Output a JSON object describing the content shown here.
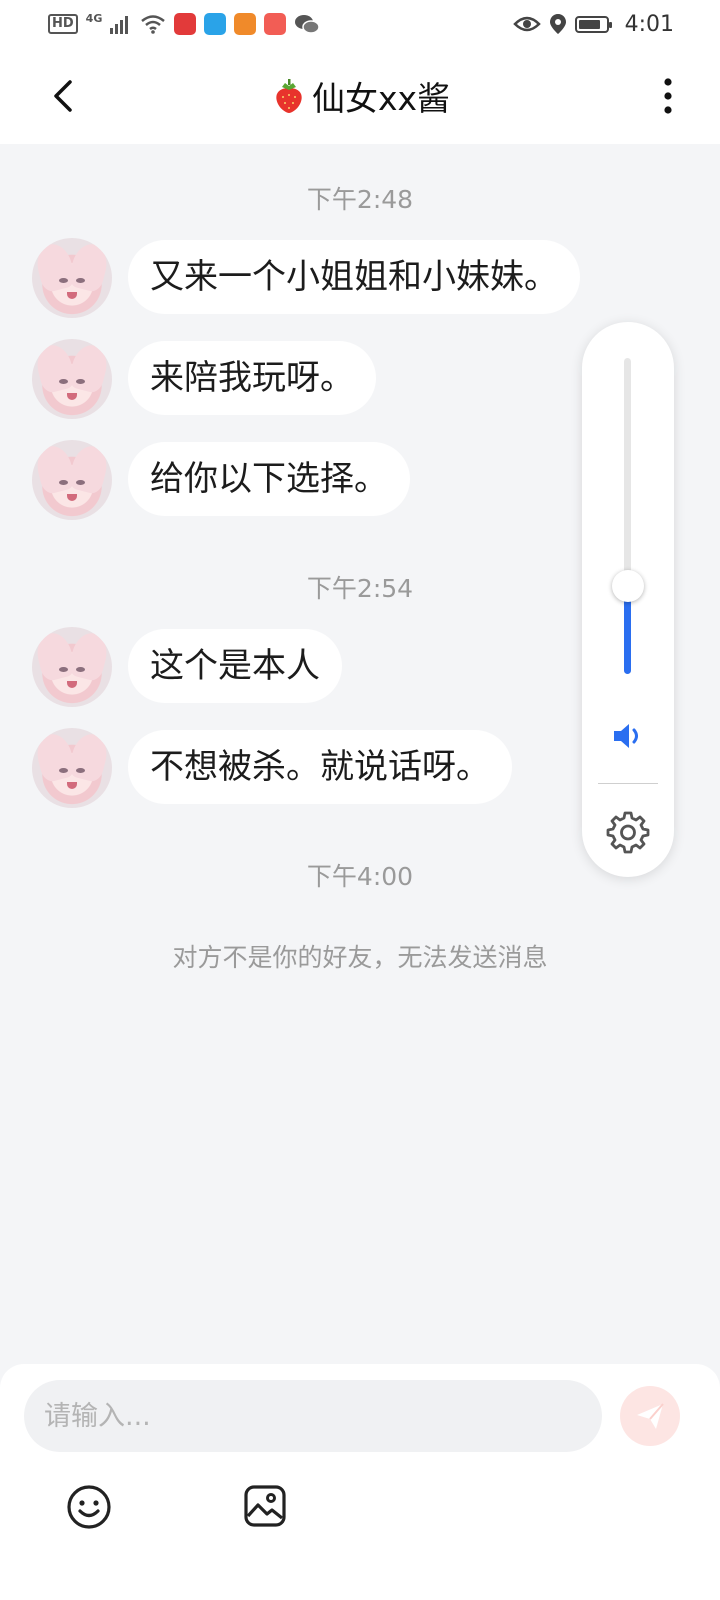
{
  "status_bar": {
    "hd": "HD",
    "network": "4G",
    "time": "4:01",
    "icons": [
      "signal-icon",
      "wifi-icon",
      "app-icon-1",
      "app-icon-2",
      "app-icon-3",
      "app-icon-4",
      "wechat-icon",
      "eye-icon",
      "location-icon",
      "battery-icon"
    ]
  },
  "header": {
    "title": "仙女xx酱",
    "title_icon": "strawberry-icon",
    "back_icon": "back-chevron-icon",
    "more_icon": "more-vertical-icon"
  },
  "chat": {
    "groups": [
      {
        "timestamp": "下午2:48",
        "messages": [
          "又来一个小姐姐和小妹妹。",
          "来陪我玩呀。",
          "给你以下选择。"
        ]
      },
      {
        "timestamp": "下午2:54",
        "messages": [
          "这个是本人",
          "不想被杀。就说话呀。"
        ]
      },
      {
        "timestamp": "下午4:00",
        "messages": []
      }
    ],
    "notice": "对方不是你的好友，无法发送消息"
  },
  "volume_panel": {
    "level": 0.28,
    "accent": "#2a6ef0",
    "speaker_icon": "speaker-icon",
    "settings_icon": "gear-icon"
  },
  "composer": {
    "placeholder": "请输入...",
    "value": "",
    "send_icon": "send-icon",
    "emoji_icon": "emoji-icon",
    "image_icon": "image-icon",
    "send_color": "#fde5e3"
  }
}
